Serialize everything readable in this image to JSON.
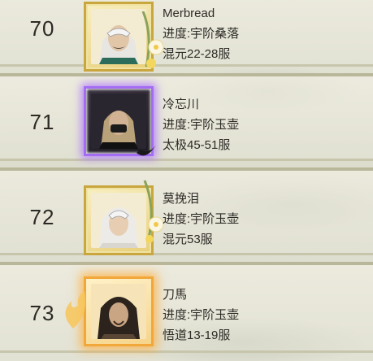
{
  "entries": [
    {
      "rank": "70",
      "name": "Merbread",
      "progress": "进度:宇阶桑落",
      "server": "混元22-28服",
      "frame": "gold",
      "avatar": "masked-white-hair-avatar"
    },
    {
      "rank": "71",
      "name": "冷忘川",
      "progress": "进度:宇阶玉壶",
      "server": "太极45-51服",
      "frame": "purple",
      "avatar": "masked-blond-avatar"
    },
    {
      "rank": "72",
      "name": "莫挽泪",
      "progress": "进度:宇阶玉壶",
      "server": "混元53服",
      "frame": "gold",
      "avatar": "white-hair-avatar"
    },
    {
      "rank": "73",
      "name": "刀馬",
      "progress": "进度:宇阶玉壶",
      "server": "悟道13-19服",
      "frame": "fire",
      "avatar": "dark-hair-avatar"
    }
  ],
  "colors": {
    "gold_frame": "#c9a63e",
    "purple_frame": "#a46cf3",
    "fire_frame": "#f1a73a",
    "text": "#2d2b26"
  }
}
